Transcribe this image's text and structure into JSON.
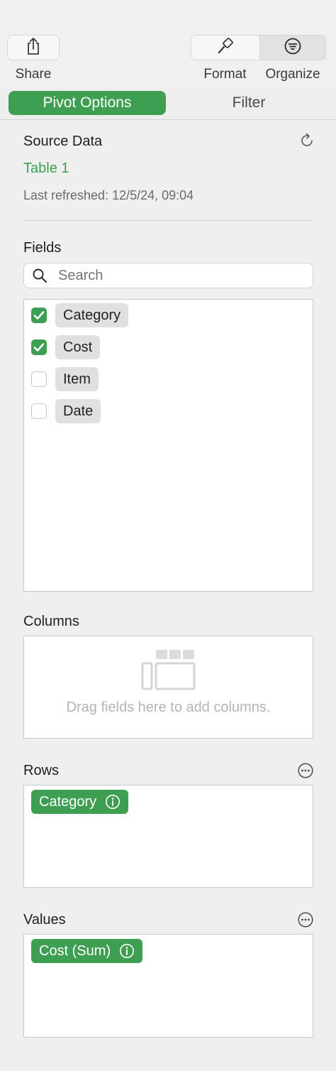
{
  "toolbar": {
    "share_label": "Share",
    "format_label": "Format",
    "organize_label": "Organize"
  },
  "tabs": [
    {
      "label": "Pivot Options",
      "active": true
    },
    {
      "label": "Filter",
      "active": false
    }
  ],
  "source_data": {
    "heading": "Source Data",
    "table_name": "Table 1",
    "last_refreshed": "Last refreshed: 12/5/24, 09:04"
  },
  "fields": {
    "heading": "Fields",
    "search_placeholder": "Search",
    "items": [
      {
        "label": "Category",
        "checked": true
      },
      {
        "label": "Cost",
        "checked": true
      },
      {
        "label": "Item",
        "checked": false
      },
      {
        "label": "Date",
        "checked": false
      }
    ]
  },
  "columns": {
    "heading": "Columns",
    "empty_hint": "Drag fields here to add columns."
  },
  "rows": {
    "heading": "Rows",
    "items": [
      "Category"
    ]
  },
  "values": {
    "heading": "Values",
    "items": [
      "Cost (Sum)"
    ]
  },
  "colors": {
    "accent": "#3e9f52"
  }
}
